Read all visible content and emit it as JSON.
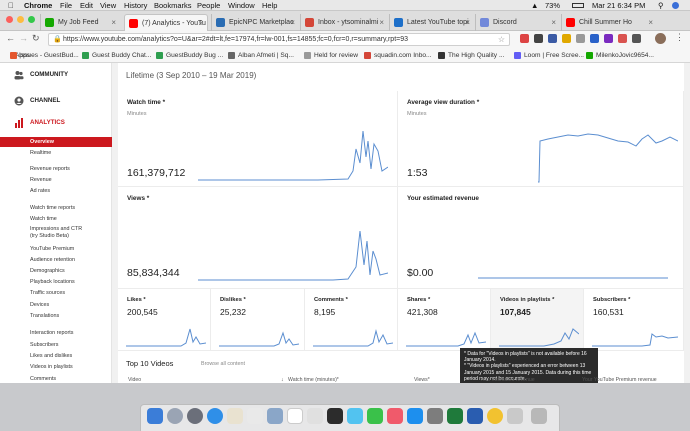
{
  "menubar": {
    "apple": "",
    "app_name": "Chrome",
    "menus": [
      "File",
      "Edit",
      "View",
      "History",
      "Bookmarks",
      "People",
      "Window",
      "Help"
    ],
    "battery": "73%",
    "clock": "Mar 21  6:34 PM"
  },
  "tabs": [
    {
      "label": "My Job Feed",
      "color": "#14a800"
    },
    {
      "label": "(7) Analytics - YouTu",
      "color": "#ff0000"
    },
    {
      "label": "EpicNPC Marketplac",
      "color": "#2a6cb3"
    },
    {
      "label": "Inbox - ytsominalmi",
      "color": "#d44638"
    },
    {
      "label": "Latest YouTube topi",
      "color": "#1d6fc9"
    },
    {
      "label": "Discord",
      "color": "#7289da"
    },
    {
      "label": "Chill Summer Ho",
      "color": "#ff0000"
    }
  ],
  "address_bar": {
    "url": "https://www.youtube.com/analytics?o=U&ar=2#dt=lt,fe=17974,fr=lw-001,fs=14855;fc=0,fcr=0,r=summary,rpt=93"
  },
  "bookmarks": [
    {
      "label": "Issues - GuestBud...",
      "color": "#e4572e"
    },
    {
      "label": "Guest Buddy Chat...",
      "color": "#2e9e4f"
    },
    {
      "label": "GuestBuddy Bug ...",
      "color": "#2e9e4f"
    },
    {
      "label": "Alban Afmeti | Sq...",
      "color": "#666"
    },
    {
      "label": "Held for review",
      "color": "#999"
    },
    {
      "label": "squadin.com Inbo...",
      "color": "#d44638"
    },
    {
      "label": "The High Quality ...",
      "color": "#333"
    },
    {
      "label": "Loom | Free Scree...",
      "color": "#625df5"
    },
    {
      "label": "MilenkoJovic9654...",
      "color": "#14a800"
    }
  ],
  "sidebar": {
    "sections": [
      {
        "label": "COMMUNITY",
        "icon": "people-icon"
      },
      {
        "label": "CHANNEL",
        "icon": "channel-icon"
      },
      {
        "label": "ANALYTICS",
        "icon": "analytics-icon"
      }
    ],
    "items": [
      "Overview",
      "Realtime",
      "Revenue reports",
      "Revenue",
      "Ad rates",
      "Watch time reports",
      "Watch time",
      "Impressions and CTR (try Studio Beta)",
      "YouTube Premium",
      "Audience retention",
      "Demographics",
      "Playback locations",
      "Traffic sources",
      "Devices",
      "Translations",
      "Interaction reports",
      "Subscribers",
      "Likes and dislikes",
      "Videos in playlists",
      "Comments",
      "Sharing"
    ]
  },
  "main": {
    "range_label": "Lifetime (3 Sep 2010 – 19 Mar 2019)",
    "cards": [
      {
        "title": "Watch time *",
        "sub": "Minutes",
        "value": "161,379,712"
      },
      {
        "title": "Average view duration *",
        "sub": "Minutes",
        "value": "1:53"
      },
      {
        "title": "Views *",
        "sub": "",
        "value": "85,834,344"
      },
      {
        "title": "Your estimated revenue",
        "sub": "",
        "value": "$0.00"
      }
    ],
    "small_stats": [
      {
        "title": "Likes *",
        "value": "200,545"
      },
      {
        "title": "Dislikes *",
        "value": "25,232"
      },
      {
        "title": "Comments *",
        "value": "8,195"
      },
      {
        "title": "Shares *",
        "value": "421,308"
      },
      {
        "title": "Videos in playlists *",
        "value": "107,845"
      },
      {
        "title": "Subscribers *",
        "value": "160,531"
      }
    ],
    "tooltip": "* Data for \"Videos in playlists\" is not available before 16 January 2014.\n* \"Videos in playlists\" experienced an error between 13 January 2015 and 15 January 2015. Data during this time period may not be accurate.",
    "top10": {
      "title": "Top 10 Videos",
      "browse": "Browse all content",
      "columns": [
        "Video",
        "Watch time (minutes)*",
        "Views*",
        "Your estimated revenue",
        "Your YouTube Premium revenue"
      ]
    }
  },
  "colors": {
    "accent": "#cc181e",
    "line": "#5b8ed0"
  }
}
